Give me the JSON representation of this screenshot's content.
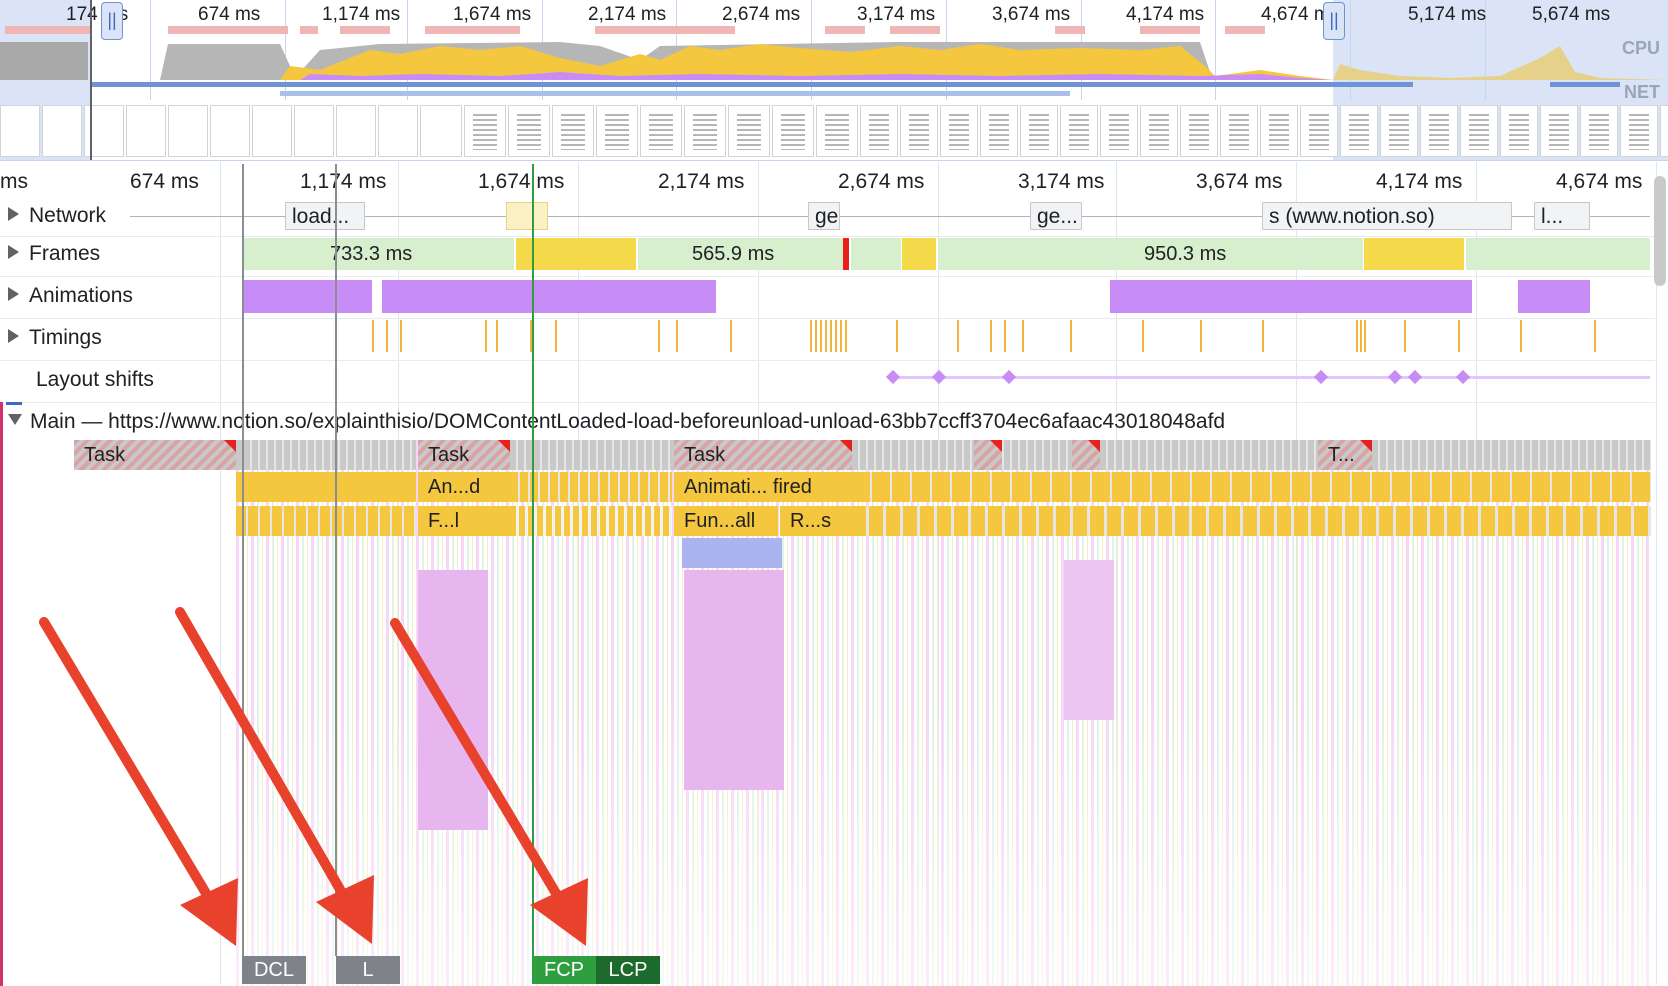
{
  "overview": {
    "ticks": [
      "174 ms",
      "674 ms",
      "1,174 ms",
      "1,674 ms",
      "2,174 ms",
      "2,674 ms",
      "3,174 ms",
      "3,674 ms",
      "4,174 ms",
      "4,674 ms",
      "5,174 ms",
      "5,674 ms"
    ],
    "cpu_label": "CPU",
    "net_label": "NET"
  },
  "ruler": {
    "ticks": [
      "ms",
      "674 ms",
      "1,174 ms",
      "1,674 ms",
      "2,174 ms",
      "2,674 ms",
      "3,174 ms",
      "3,674 ms",
      "4,174 ms",
      "4,674 ms"
    ]
  },
  "tracks": {
    "network": {
      "label": "Network",
      "requests": [
        "load...",
        "ge",
        "ge...",
        "s (www.notion.so)",
        "l..."
      ]
    },
    "frames": {
      "label": "Frames",
      "durations": [
        "733.3 ms",
        "565.9 ms",
        "950.3 ms"
      ]
    },
    "animations": {
      "label": "Animations"
    },
    "timings": {
      "label": "Timings"
    },
    "layout_shifts": {
      "label": "Layout shifts"
    },
    "main": {
      "label": "Main — https://www.notion.so/explainthisio/DOMContentLoaded-load-beforeunload-unload-63bb7ccff3704ec6afaac43018048afd",
      "tasks": [
        "Task",
        "Task",
        "Task",
        "T..."
      ],
      "row2": [
        "An...d",
        "Animati... fired"
      ],
      "row3": [
        "F...l",
        "Fun...all",
        "R...s"
      ]
    }
  },
  "markers": {
    "dcl": "DCL",
    "load": "L",
    "fcp": "FCP",
    "lcp": "LCP"
  },
  "colors": {
    "scripting": "#f4c73f",
    "rendering": "#c88cf7",
    "painting": "#7dd27d",
    "long_task": "#e8211d",
    "annotation_arrow": "#e8412c",
    "fcp": "#2e9e3f",
    "lcp": "#1d6b2c",
    "dcl": "#7f8389"
  }
}
